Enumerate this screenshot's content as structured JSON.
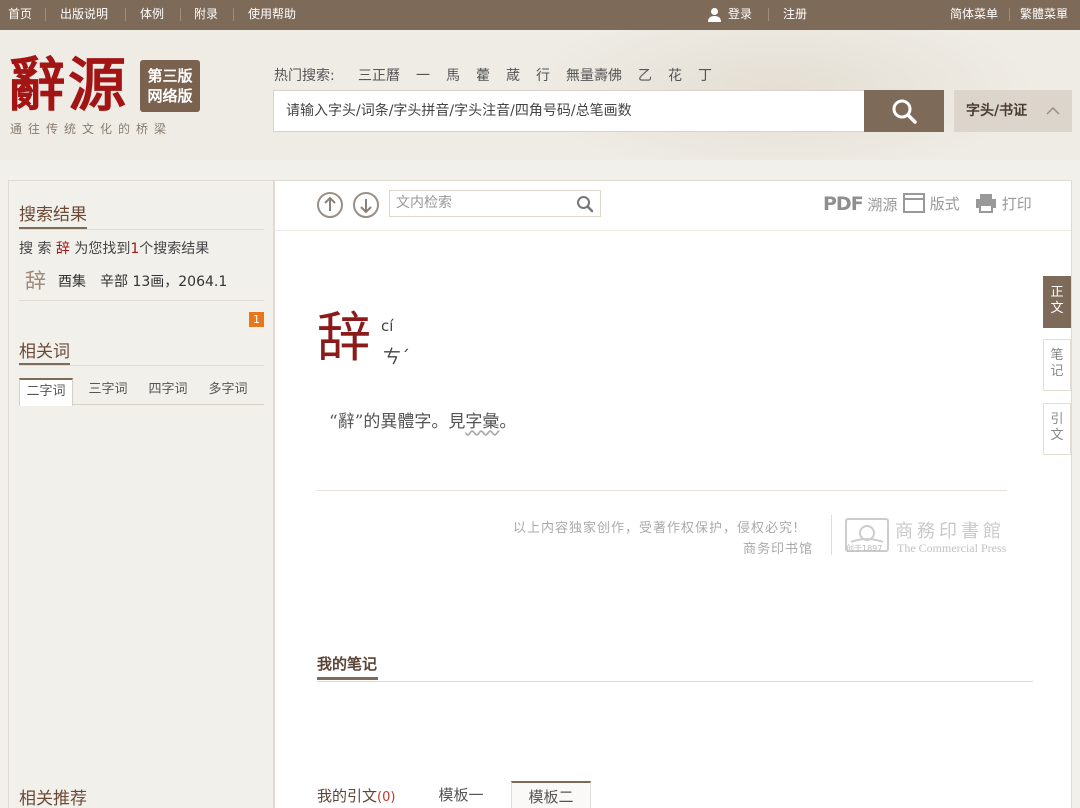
{
  "topnav": {
    "left": [
      "首页",
      "出版说明",
      "体例",
      "附录",
      "使用帮助"
    ],
    "login": "登录",
    "register": "注册",
    "simplified": "简体菜单",
    "traditional": "繁體菜單"
  },
  "header": {
    "logo": "辭源",
    "edition_line1": "第三版",
    "edition_line2": "网络版",
    "slogan": "通往传统文化的桥梁",
    "hot_label": "热门搜索:",
    "hot_words": [
      "三正曆",
      "一",
      "馬",
      "藿",
      "葴",
      "行",
      "無量壽佛",
      "乙",
      "花",
      "丁"
    ],
    "search_placeholder": "请输入字头/词条/字头拼音/字头注音/四角号码/总笔画数",
    "search_type": "字头/书证"
  },
  "left": {
    "results_title": "搜索结果",
    "result_prefix": "搜 索",
    "result_query": "辞",
    "result_mid": "为您找到",
    "result_count": "1",
    "result_suffix": "个搜索结果",
    "result_item": {
      "char": "辞",
      "info": "酉集　辛部 13画，2064.1"
    },
    "badge": "1",
    "related_title": "相关词",
    "tabs": [
      "二字词",
      "三字词",
      "四字词",
      "多字词"
    ],
    "recommend_title": "相关推荐"
  },
  "main": {
    "inner_search_placeholder": "文内检索",
    "pdf": "PDF",
    "source": "溯源",
    "layout": "版式",
    "print": "打印",
    "headword": "辞",
    "pinyin": "cí",
    "zhuyin": "ㄘˊ",
    "def_before": "“辭”的異體字。見",
    "def_link": "字彙",
    "def_after": "。",
    "copyright_line1": "以上内容独家创作，受著作权保护，侵权必究!",
    "copyright_line2": "商务印书馆",
    "publisher_cn": "商務印書館",
    "publisher_since": "创于1897",
    "publisher_en": "The Commercial Press",
    "notes_title": "我的笔记",
    "citations_label": "我的引文",
    "citations_count": "(0)",
    "template1": "模板一",
    "template2": "模板二"
  },
  "side_tabs": [
    "正文",
    "笔记",
    "引文"
  ],
  "colors": {
    "brown": "#7e6a58",
    "accent_red": "#a31515"
  }
}
